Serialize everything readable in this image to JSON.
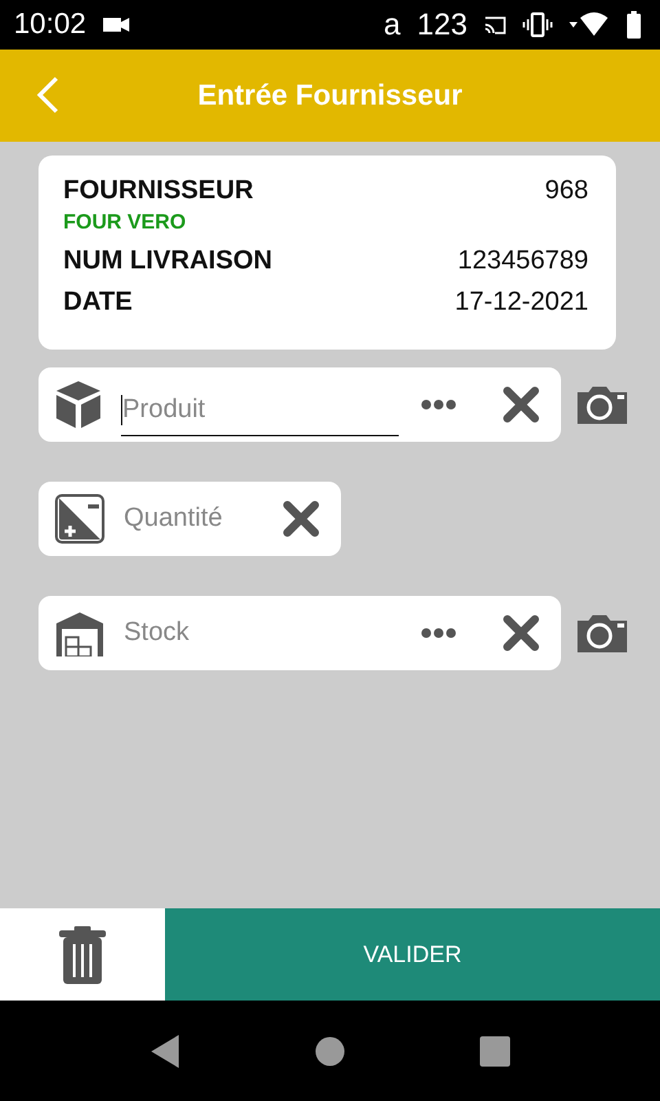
{
  "status_bar": {
    "time": "10:02",
    "indicators": [
      "a",
      "123"
    ]
  },
  "header": {
    "title": "Entrée Fournisseur"
  },
  "info_card": {
    "rows": [
      {
        "label": "FOURNISSEUR",
        "value": "968",
        "sub": "FOUR VERO"
      },
      {
        "label": "NUM LIVRAISON",
        "value": "123456789"
      },
      {
        "label": "DATE",
        "value": "17-12-2021"
      }
    ]
  },
  "fields": [
    {
      "kind": "product",
      "placeholder": "Produit",
      "focused": true,
      "more": true,
      "camera": true
    },
    {
      "kind": "quantity",
      "placeholder": "Quantité",
      "focused": false,
      "more": false,
      "camera": false
    },
    {
      "kind": "stock",
      "placeholder": "Stock",
      "focused": false,
      "more": true,
      "camera": true
    }
  ],
  "footer": {
    "validate_label": "VALIDER"
  }
}
